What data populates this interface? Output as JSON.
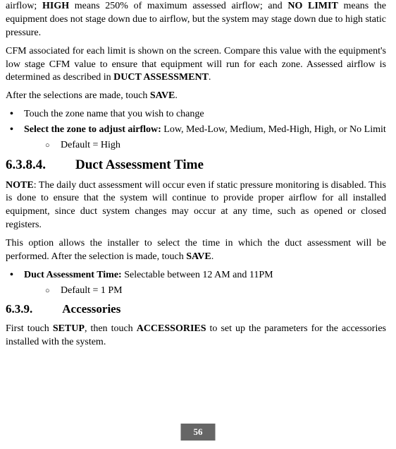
{
  "intro": {
    "p1_a": "airflow; ",
    "p1_high": "HIGH",
    "p1_b": " means 250% of maximum assessed airflow; and ",
    "p1_nolimit": "NO LIMIT",
    "p1_c": " means the equipment does not stage down due to airflow, but the system may stage down due to high static pressure.",
    "p2_a": "CFM associated for each limit is shown on the screen. Compare this value with the equipment's low stage CFM value to ensure that equipment will run for each zone. Assessed airflow is determined as described in ",
    "p2_bold": "DUCT ASSESSMENT",
    "p2_b": ".",
    "p3_a": "After the selections are made, touch ",
    "p3_bold": "SAVE",
    "p3_b": "."
  },
  "list1": {
    "item1": "Touch the zone name that you wish to change",
    "item2_bold": "Select the zone to adjust airflow:",
    "item2_rest": " Low, Med-Low, Medium, Med-High, High, or No Limit",
    "sub1": "Default = High"
  },
  "section1": {
    "num": "6.3.8.4.",
    "title": "Duct Assessment Time",
    "note_label": "NOTE",
    "note_text": ":  The daily duct assessment will occur even if static pressure monitoring is disabled. This is done to ensure that the system will continue to provide proper airflow for all installed equipment, since duct system changes may occur at any time, such as opened or closed registers.",
    "p2_a": "This option allows the installer to select the time in which the duct assessment will be performed. After the selection is made, touch ",
    "p2_bold": "SAVE",
    "p2_b": "."
  },
  "list2": {
    "item1_bold": "Duct Assessment Time:",
    "item1_rest": " Selectable between 12 AM and 11PM",
    "sub1": "Default = 1 PM"
  },
  "section2": {
    "num": "6.3.9.",
    "title": "Accessories",
    "p1_a": "First touch ",
    "p1_bold1": "SETUP",
    "p1_b": ", then touch ",
    "p1_bold2": "ACCESSORIES",
    "p1_c": " to set up the parameters for the accessories installed with the system."
  },
  "page_number": "56"
}
